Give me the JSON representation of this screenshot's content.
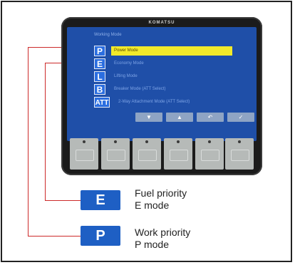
{
  "monitor": {
    "brand": "KOMATSU",
    "screen_title": "Working Mode",
    "modes": [
      {
        "code": "P",
        "label": "Power Mode",
        "selected": true
      },
      {
        "code": "E",
        "label": "Economy Mode",
        "selected": false
      },
      {
        "code": "L",
        "label": "Lifting Mode",
        "selected": false
      },
      {
        "code": "B",
        "label": "Breaker Mode (ATT Select)",
        "selected": false
      },
      {
        "code": "ATT",
        "label": "2-Way Attachment Mode (ATT Select)",
        "selected": false
      }
    ],
    "nav_buttons": [
      "▼",
      "▲",
      "↶",
      "✓"
    ]
  },
  "legend": [
    {
      "code": "E",
      "line1": "Fuel priority",
      "line2": "E mode"
    },
    {
      "code": "P",
      "line1": "Work priority",
      "line2": "P mode"
    }
  ],
  "colors": {
    "screen": "#1f4fa8",
    "selected_row": "#f2ea2a",
    "badge": "#1e5fc4",
    "callout": "#cc2a2a"
  }
}
